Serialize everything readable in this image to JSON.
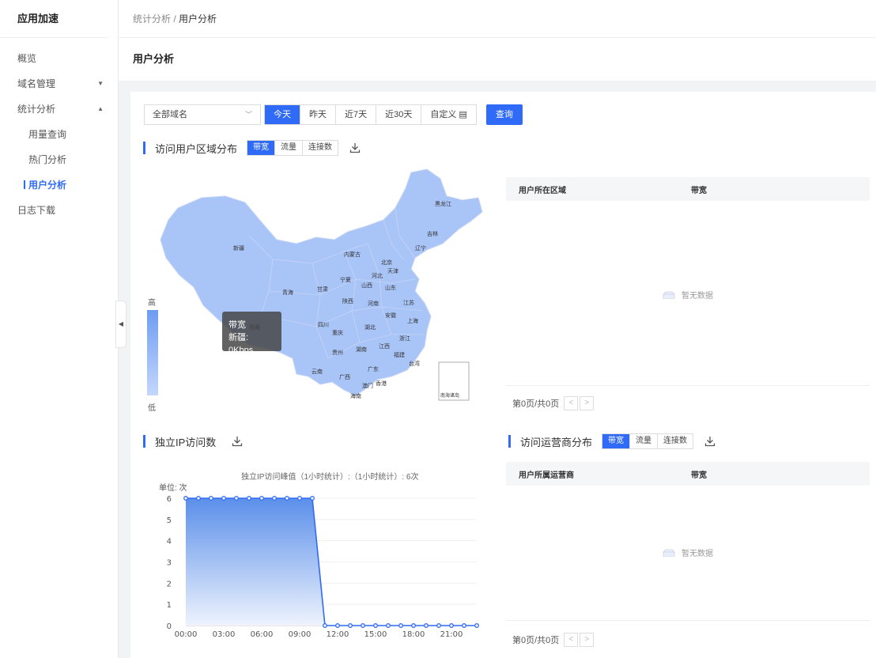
{
  "sidebar": {
    "title": "应用加速",
    "items": [
      {
        "label": "概览"
      },
      {
        "label": "域名管理",
        "arrow": "▼"
      },
      {
        "label": "统计分析",
        "arrow": "▲"
      },
      {
        "label": "用量查询"
      },
      {
        "label": "热门分析"
      },
      {
        "label": "用户分析"
      },
      {
        "label": "日志下载"
      }
    ],
    "collapse_glyph": "◀"
  },
  "breadcrumb": {
    "parent": "统计分析",
    "sep": " / ",
    "current": "用户分析"
  },
  "page_title": "用户分析",
  "filter": {
    "domain_value": "全部域名",
    "chevron": "﹀",
    "ranges": [
      "今天",
      "昨天",
      "近7天",
      "近30天",
      "自定义 ▤"
    ],
    "query_label": "查询"
  },
  "region": {
    "title": "访问用户区域分布",
    "tabs": [
      "带宽",
      "流量",
      "连接数"
    ],
    "legend_high": "高",
    "legend_low": "低",
    "tooltip_title": "带宽",
    "tooltip_value": "新疆: 0Kbps",
    "provinces": [
      "黑龙江",
      "吉林",
      "辽宁",
      "内蒙古",
      "北京",
      "天津",
      "河北",
      "新疆",
      "宁夏",
      "山西",
      "山东",
      "青海",
      "甘肃",
      "陕西",
      "河南",
      "江苏",
      "安徽",
      "上海",
      "西藏",
      "四川",
      "重庆",
      "湖北",
      "浙江",
      "贵州",
      "湖南",
      "江西",
      "福建",
      "台湾",
      "云南",
      "广西",
      "广东",
      "澳门",
      "香港",
      "海南",
      "南海诸岛"
    ],
    "table": {
      "col1": "用户所在区域",
      "col2": "带宽",
      "empty": "暂无数据",
      "pager": "第0页/共0页"
    }
  },
  "ip": {
    "title": "独立IP访问数",
    "subtitle": "独立IP访问峰值（1小时统计）:（1小时统计）: 6次",
    "unit": "单位: 次"
  },
  "isp": {
    "title": "访问运营商分布",
    "tabs": [
      "带宽",
      "流量",
      "连接数"
    ],
    "table": {
      "col1": "用户所属运营商",
      "col2": "带宽",
      "empty": "暂无数据",
      "pager": "第0页/共0页"
    }
  },
  "chart_data": {
    "type": "area",
    "x": [
      "00:00",
      "01:00",
      "02:00",
      "03:00",
      "04:00",
      "05:00",
      "06:00",
      "07:00",
      "08:00",
      "09:00",
      "10:00",
      "11:00",
      "12:00",
      "13:00",
      "14:00",
      "15:00",
      "16:00",
      "17:00",
      "18:00",
      "19:00",
      "20:00",
      "21:00",
      "22:00",
      "23:00"
    ],
    "values": [
      6,
      6,
      6,
      6,
      6,
      6,
      6,
      6,
      6,
      6,
      6,
      0,
      0,
      0,
      0,
      0,
      0,
      0,
      0,
      0,
      0,
      0,
      0,
      0
    ],
    "xticks": [
      "00:00",
      "03:00",
      "06:00",
      "09:00",
      "12:00",
      "15:00",
      "18:00",
      "21:00"
    ],
    "yticks": [
      0,
      1,
      2,
      3,
      4,
      5,
      6
    ],
    "ylim": [
      0,
      6
    ],
    "line_color": "#2f6bf6"
  },
  "colors": {
    "accent": "#2f6bf6",
    "map_fill": "#a9c4f7",
    "map_stroke": "#c6d5f5"
  }
}
